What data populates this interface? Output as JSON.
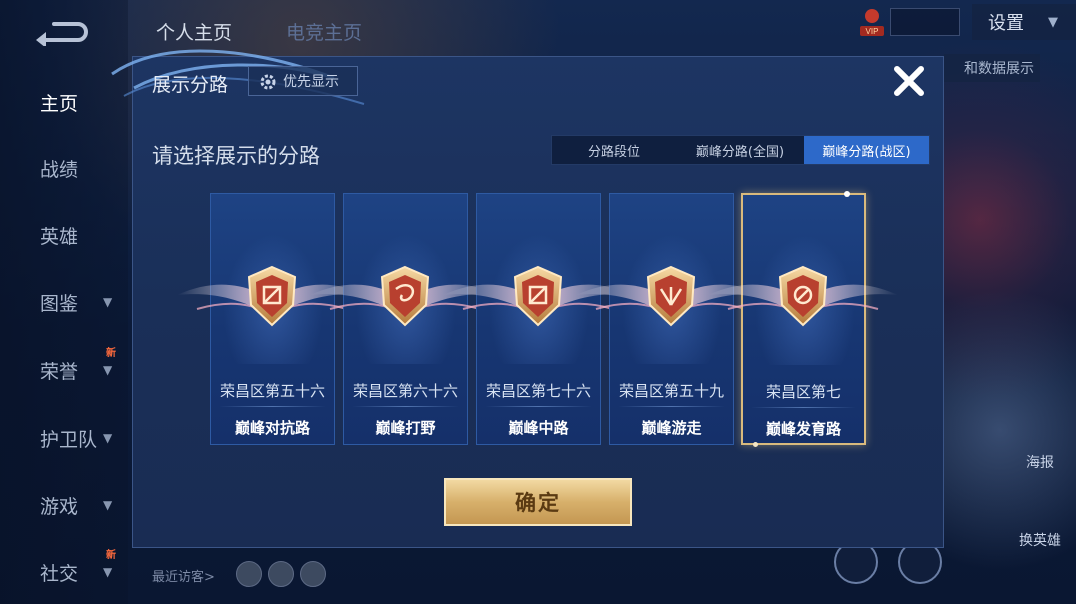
{
  "sidebar": {
    "items": [
      {
        "label": "主页",
        "active": true,
        "chevron": false,
        "badge": ""
      },
      {
        "label": "战绩",
        "active": false,
        "chevron": false,
        "badge": ""
      },
      {
        "label": "英雄",
        "active": false,
        "chevron": false,
        "badge": ""
      },
      {
        "label": "图鉴",
        "active": false,
        "chevron": true,
        "badge": ""
      },
      {
        "label": "荣誉",
        "active": false,
        "chevron": true,
        "badge": "新"
      },
      {
        "label": "护卫队",
        "active": false,
        "chevron": true,
        "badge": ""
      },
      {
        "label": "游戏",
        "active": false,
        "chevron": true,
        "badge": ""
      },
      {
        "label": "社交",
        "active": false,
        "chevron": true,
        "badge": "新"
      }
    ]
  },
  "topbar": {
    "tabs": [
      "个人主页",
      "电竞主页"
    ],
    "vip_label": "VIP",
    "settings_label": "设置",
    "behind_text": "和数据展示"
  },
  "footer": {
    "visitors_label": "最近访客>",
    "poster_label": "海报",
    "swap_label": "换英雄"
  },
  "dialog": {
    "title": "展示分路",
    "priority_label": "优先显示",
    "subtitle": "请选择展示的分路",
    "segments": [
      {
        "label": "分路段位",
        "active": false
      },
      {
        "label": "巅峰分路(全国)",
        "active": false
      },
      {
        "label": "巅峰分路(战区)",
        "active": true
      }
    ],
    "cards": [
      {
        "server": "荣昌区第五十六",
        "role": "巅峰对抗路",
        "icon": "sword-crossed-icon",
        "selected": false
      },
      {
        "server": "荣昌区第六十六",
        "role": "巅峰打野",
        "icon": "jungle-swirl-icon",
        "selected": false
      },
      {
        "server": "荣昌区第七十六",
        "role": "巅峰中路",
        "icon": "mid-lane-icon",
        "selected": false
      },
      {
        "server": "荣昌区第五十九",
        "role": "巅峰游走",
        "icon": "support-wings-icon",
        "selected": false
      },
      {
        "server": "荣昌区第七",
        "role": "巅峰发育路",
        "icon": "adc-target-icon",
        "selected": true
      }
    ],
    "confirm_label": "确定"
  },
  "colors": {
    "accent_blue": "#2d69c9",
    "gold": "#d7b06b",
    "dialog_bg": "#1b325d"
  }
}
